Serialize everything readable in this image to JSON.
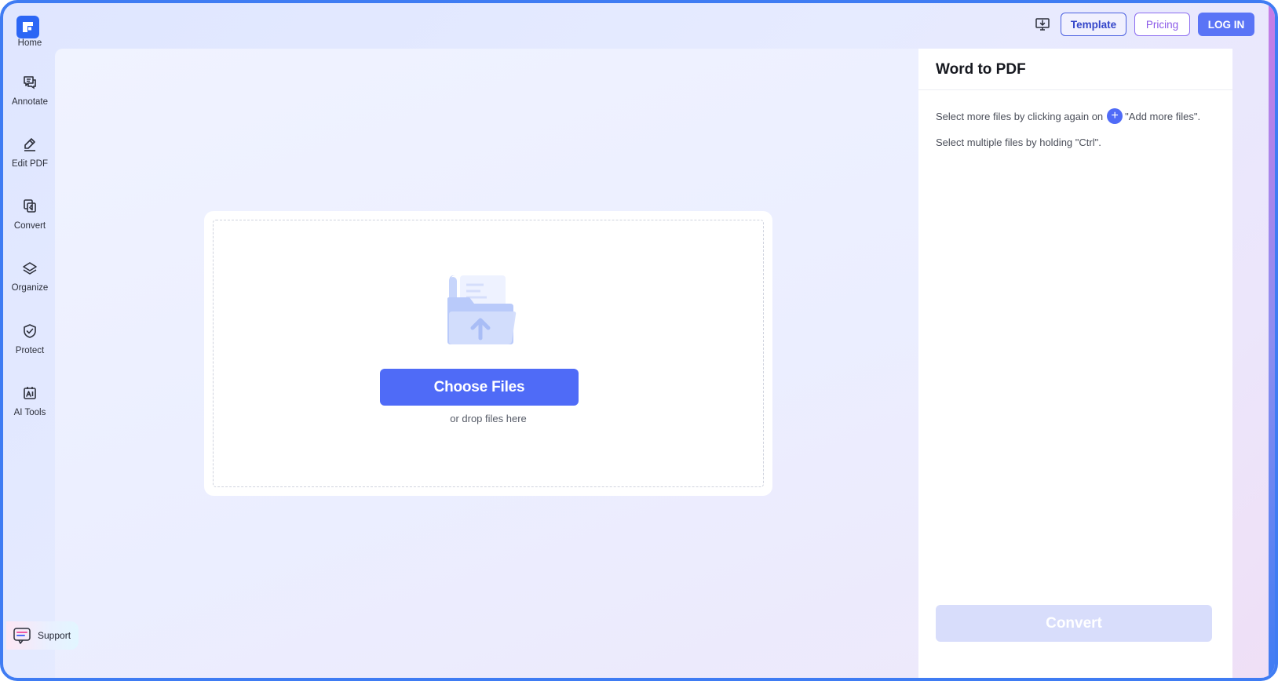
{
  "sidebar": {
    "items": [
      {
        "label": "Home",
        "icon": "logo-icon"
      },
      {
        "label": "Annotate",
        "icon": "annotate-icon"
      },
      {
        "label": "Edit PDF",
        "icon": "edit-pdf-icon"
      },
      {
        "label": "Convert",
        "icon": "convert-icon"
      },
      {
        "label": "Organize",
        "icon": "organize-icon"
      },
      {
        "label": "Protect",
        "icon": "protect-icon"
      },
      {
        "label": "AI Tools",
        "icon": "ai-tools-icon"
      }
    ],
    "support_label": "Support"
  },
  "topbar": {
    "template_label": "Template",
    "pricing_label": "Pricing",
    "login_label": "LOG IN"
  },
  "upload": {
    "choose_label": "Choose Files",
    "hint": "or drop files here"
  },
  "panel": {
    "title": "Word to PDF",
    "line1_before": "Select more files by clicking again on",
    "line1_after": "\"Add more files\".",
    "line2": "Select multiple files by holding \"Ctrl\".",
    "convert_label": "Convert"
  },
  "colors": {
    "accent": "#4f6bf7",
    "frame_border": "#3f7cf3",
    "convert_disabled": "#d8ddfb"
  }
}
